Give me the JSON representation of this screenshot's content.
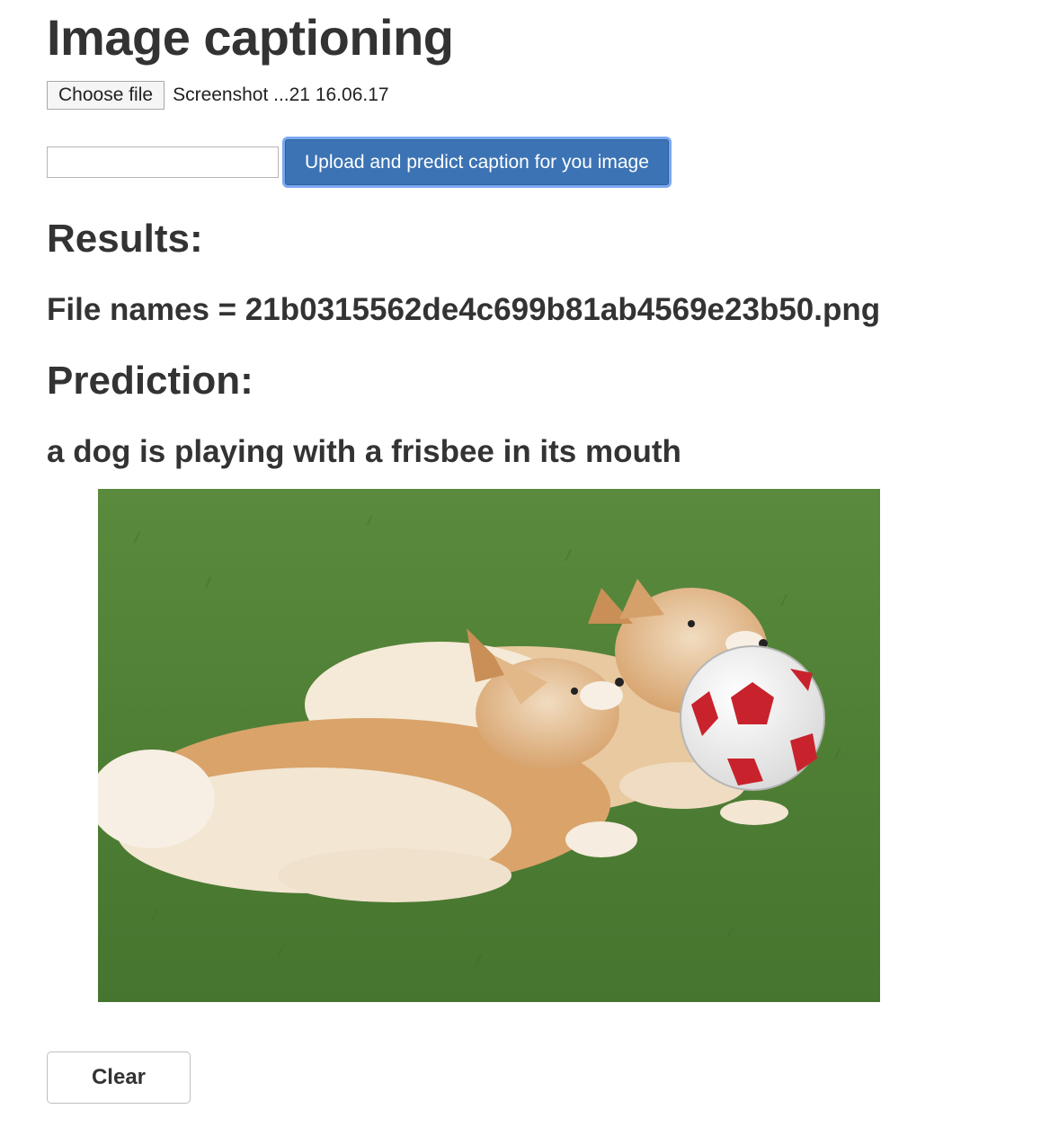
{
  "page": {
    "title": "Image captioning"
  },
  "upload_form": {
    "choose_file_label": "Choose file",
    "selected_file_name": "Screenshot ...21 16.06.17",
    "text_field_value": "",
    "submit_label": "Upload and predict caption for you image"
  },
  "results": {
    "heading": "Results:",
    "file_names_line": "File names = 21b0315562de4c699b81ab4569e23b50.png"
  },
  "prediction": {
    "heading": "Prediction:",
    "caption": "a dog is playing with a frisbee in its mouth"
  },
  "image": {
    "subject": "two corgis chasing a red and white soccer ball on grass",
    "colors": {
      "grass": "#4f7f35",
      "grass_dark": "#3d6a28",
      "fur_tan": "#d9a36a",
      "fur_cream": "#f3e6d2",
      "ball_red": "#c8232c",
      "ball_white": "#f4f4f4"
    }
  },
  "actions": {
    "clear_label": "Clear"
  },
  "theme": {
    "primary_button": "#3c73b4",
    "focus_ring": "#7aa7f2",
    "text": "#333333"
  }
}
